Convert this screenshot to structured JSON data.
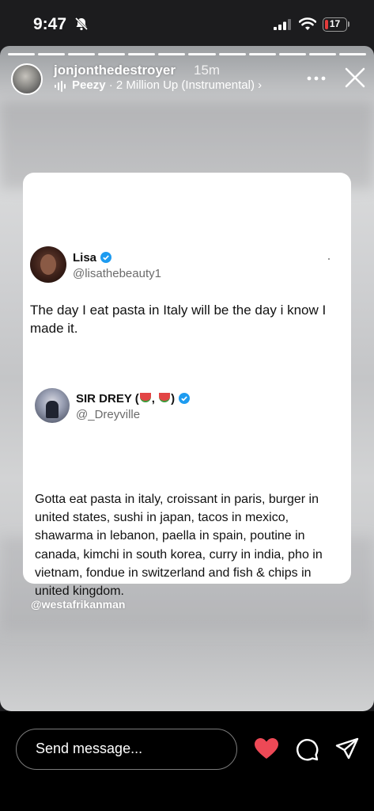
{
  "status_bar": {
    "time": "9:47",
    "battery": "17"
  },
  "story": {
    "username": "jonjonthedestroyer",
    "time_ago": "15m",
    "music_artist": "Peezy",
    "music_separator": " · ",
    "music_track": "2 Million Up (Instrumental)",
    "music_chevron": "›",
    "progress_total": 12,
    "progress_current": 12,
    "credit": "@westafrikanman"
  },
  "tweet_main": {
    "name": "Lisa",
    "handle": "@lisathebeauty1",
    "text": "The day I eat pasta in Italy will be the day i know I made it."
  },
  "tweet_quote": {
    "name_prefix": "SIR DREY (",
    "name_middle": ",",
    "name_suffix": ")",
    "handle": "@_Dreyville",
    "text": "Gotta eat pasta in italy, croissant in paris, burger in united states, sushi in japan, tacos in mexico, shawarma in lebanon, paella in spain, poutine in canada, kimchi in south korea, curry in india, pho in vietnam, fondue in switzerland and fish & chips in united kingdom."
  },
  "composer": {
    "placeholder": "Send message..."
  },
  "colors": {
    "verified": "#1d9bf0",
    "heart": "#ed4956",
    "battery_low": "#e23b3b"
  }
}
